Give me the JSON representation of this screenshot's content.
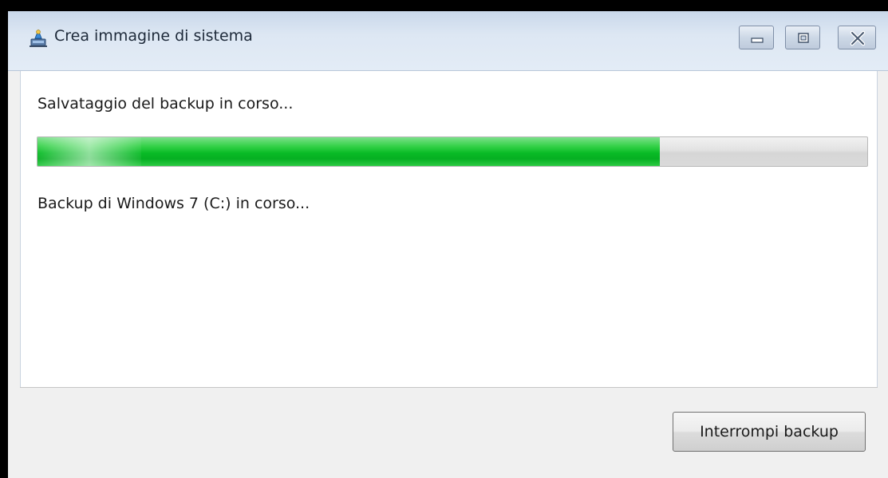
{
  "window": {
    "title": "Crea immagine di sistema",
    "icon": "backup-computer-icon"
  },
  "caption_buttons": {
    "minimize_icon": "minimize-icon",
    "maximize_icon": "maximize-icon",
    "close_icon": "close-icon"
  },
  "content": {
    "status_text": "Salvataggio del backup in corso...",
    "detail_text": "Backup di Windows 7 (C:) in corso...",
    "progress": {
      "fraction": 0.75,
      "color": "#06b022"
    }
  },
  "footer": {
    "stop_button_label": "Interrompi backup"
  }
}
